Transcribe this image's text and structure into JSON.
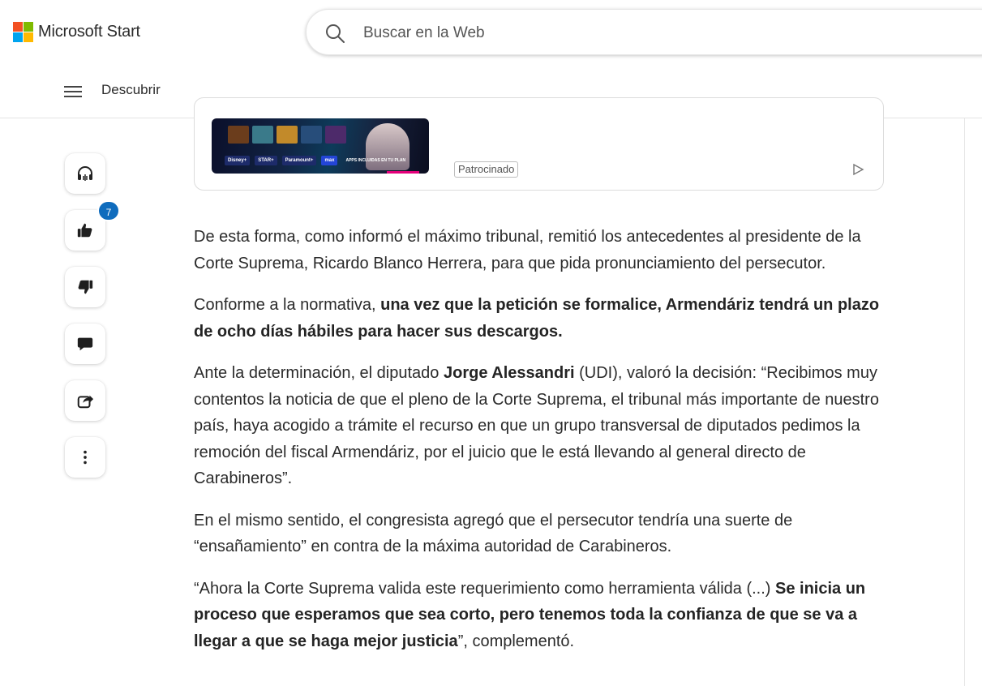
{
  "header": {
    "brand": "Microsoft Start",
    "logo_colors": [
      "#f25022",
      "#7fba00",
      "#00a4ef",
      "#ffb900"
    ],
    "search_placeholder": "Buscar en la Web"
  },
  "nav": {
    "menu_icon": "hamburger-icon",
    "label": "Descubrir"
  },
  "actions": {
    "listen_icon": "headphones-icon",
    "like_icon": "thumbs-up-icon",
    "like_count": "7",
    "dislike_icon": "thumbs-down-icon",
    "comment_icon": "comment-icon",
    "share_icon": "share-icon",
    "more_icon": "more-vertical-icon"
  },
  "ad": {
    "sponsored_label": "Patrocinado",
    "logos": [
      "Disney+",
      "STAR+",
      "Paramount+",
      "max",
      "APPS INCLUIDAS EN TU PLAN"
    ],
    "choice_icon": "ad-choices-icon"
  },
  "article": {
    "p1": "De esta forma, como informó el máximo tribunal, remitió los antecedentes al presidente de la Corte Suprema, Ricardo Blanco Herrera, para que pida pronunciamiento del persecutor.",
    "p2_pre": "Conforme a la normativa, ",
    "p2_bold": "una vez que la petición se formalice, Armendáriz tendrá un plazo de ocho días hábiles para hacer sus descargos.",
    "p3_pre": "Ante la determinación, el diputado ",
    "p3_bold": "Jorge Alessandri",
    "p3_post": " (UDI), valoró la decisión: “Recibimos muy contentos la noticia de que el pleno de la Corte Suprema, el tribunal más importante de nuestro país, haya acogido a trámite el recurso en que un grupo transversal de diputados pedimos la remoción del fiscal Armendáriz, por el juicio que le está llevando al general directo de Carabineros”.",
    "p4": "En el mismo sentido, el congresista agregó que el persecutor tendría una suerte de “ensañamiento” en contra de la máxima autoridad de Carabineros.",
    "p5_pre": "“Ahora la Corte Suprema valida este requerimiento como herramienta válida (...) ",
    "p5_bold": "Se inicia un proceso que esperamos que sea corto, pero tenemos toda la confianza de que se va a llegar a que se haga mejor justicia",
    "p5_post": "”, complementó."
  }
}
